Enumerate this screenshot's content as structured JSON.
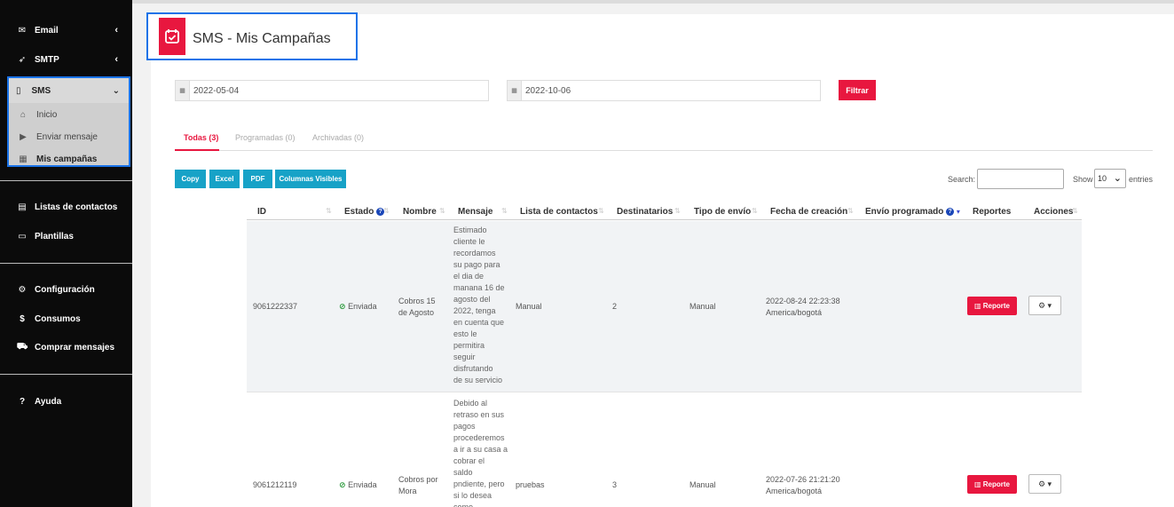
{
  "sidebar": {
    "items": [
      {
        "label": "Email"
      },
      {
        "label": "SMTP"
      },
      {
        "label": "SMS"
      },
      {
        "label": "Listas de contactos"
      },
      {
        "label": "Plantillas"
      },
      {
        "label": "Configuración"
      },
      {
        "label": "Consumos"
      },
      {
        "label": "Comprar mensajes"
      },
      {
        "label": "Ayuda"
      }
    ],
    "sms_sub": [
      {
        "label": "Inicio"
      },
      {
        "label": "Enviar mensaje"
      },
      {
        "label": "Mis campañas"
      }
    ]
  },
  "page": {
    "title": "SMS - Mis Campañas"
  },
  "filters": {
    "date_from": "2022-05-04",
    "date_to": "2022-10-06",
    "filter_label": "Filtrar"
  },
  "tabs": [
    {
      "label": "Todas (3)"
    },
    {
      "label": "Programadas (0)"
    },
    {
      "label": "Archivadas (0)"
    }
  ],
  "export": {
    "copy": "Copy",
    "excel": "Excel",
    "pdf": "PDF",
    "columns": "Columnas Visibles"
  },
  "table_controls": {
    "search_label": "Search:",
    "show_label": "Show",
    "show_value": "10",
    "entries_label": "entries"
  },
  "columns": [
    "ID",
    "Estado",
    "Nombre",
    "Mensaje",
    "Lista de contactos",
    "Destinatarios",
    "Tipo de envío",
    "Fecha de creación",
    "Envío programado",
    "Reportes",
    "Acciones"
  ],
  "rows": [
    {
      "id": "9061222337",
      "estado": "Enviada",
      "nombre_l1": "Cobros 15",
      "nombre_l2": "de Agosto",
      "mensaje": [
        "Estimado",
        "cliente le",
        "recordamos",
        "su pago para",
        "el dia de",
        "manana 16 de",
        "agosto del",
        "2022, tenga",
        "en cuenta que",
        "esto le",
        "permitira",
        "seguir",
        "disfrutando",
        "de su servicio"
      ],
      "lista": "Manual",
      "destinatarios": "2",
      "tipo": "Manual",
      "fecha_l1": "2022-08-24 22:23:38",
      "fecha_l2": "America/bogotá",
      "reporte": "Reporte"
    },
    {
      "id": "9061212119",
      "estado": "Enviada",
      "nombre_l1": "Cobros por",
      "nombre_l2": "Mora",
      "mensaje": [
        "Debido al",
        "retraso en sus",
        "pagos",
        "procederemos",
        "a ir a su casa a",
        "cobrar el",
        "saldo",
        "pndiente, pero",
        "si lo desea",
        "como"
      ],
      "lista": "pruebas",
      "destinatarios": "3",
      "tipo": "Manual",
      "fecha_l1": "2022-07-26 21:21:20",
      "fecha_l2": "America/bogotá",
      "reporte": "Reporte"
    }
  ]
}
